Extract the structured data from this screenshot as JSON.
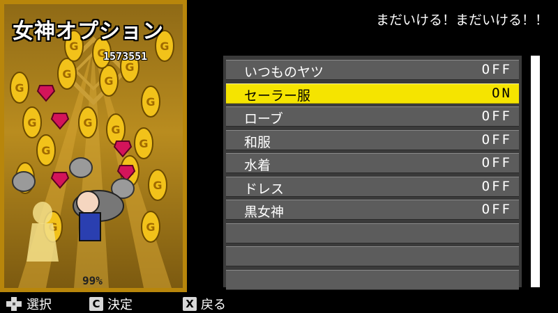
{
  "panel": {
    "title": "女神オプション",
    "score": "1573551",
    "percent": "99%"
  },
  "message": "まだいける！まだいける！！",
  "menu": {
    "items": [
      {
        "label": "いつものヤツ",
        "value": "OFF"
      },
      {
        "label": "セーラー服",
        "value": "ON"
      },
      {
        "label": "ローブ",
        "value": "OFF"
      },
      {
        "label": "和服",
        "value": "OFF"
      },
      {
        "label": "水着",
        "value": "OFF"
      },
      {
        "label": "ドレス",
        "value": "OFF"
      },
      {
        "label": "黒女神",
        "value": "OFF"
      }
    ],
    "empty_rows": 3,
    "selected_index": 1
  },
  "help": {
    "select_label": "選択",
    "confirm_key": "C",
    "confirm_label": "決定",
    "back_key": "X",
    "back_label": "戻る"
  },
  "colors": {
    "highlight": "#f5e400",
    "row": "#5c5c5c",
    "gold": "#b8860b"
  },
  "icons": [
    "gold-coin-icon",
    "ruby-gem-icon",
    "money-bag-icon",
    "dpad-icon"
  ]
}
